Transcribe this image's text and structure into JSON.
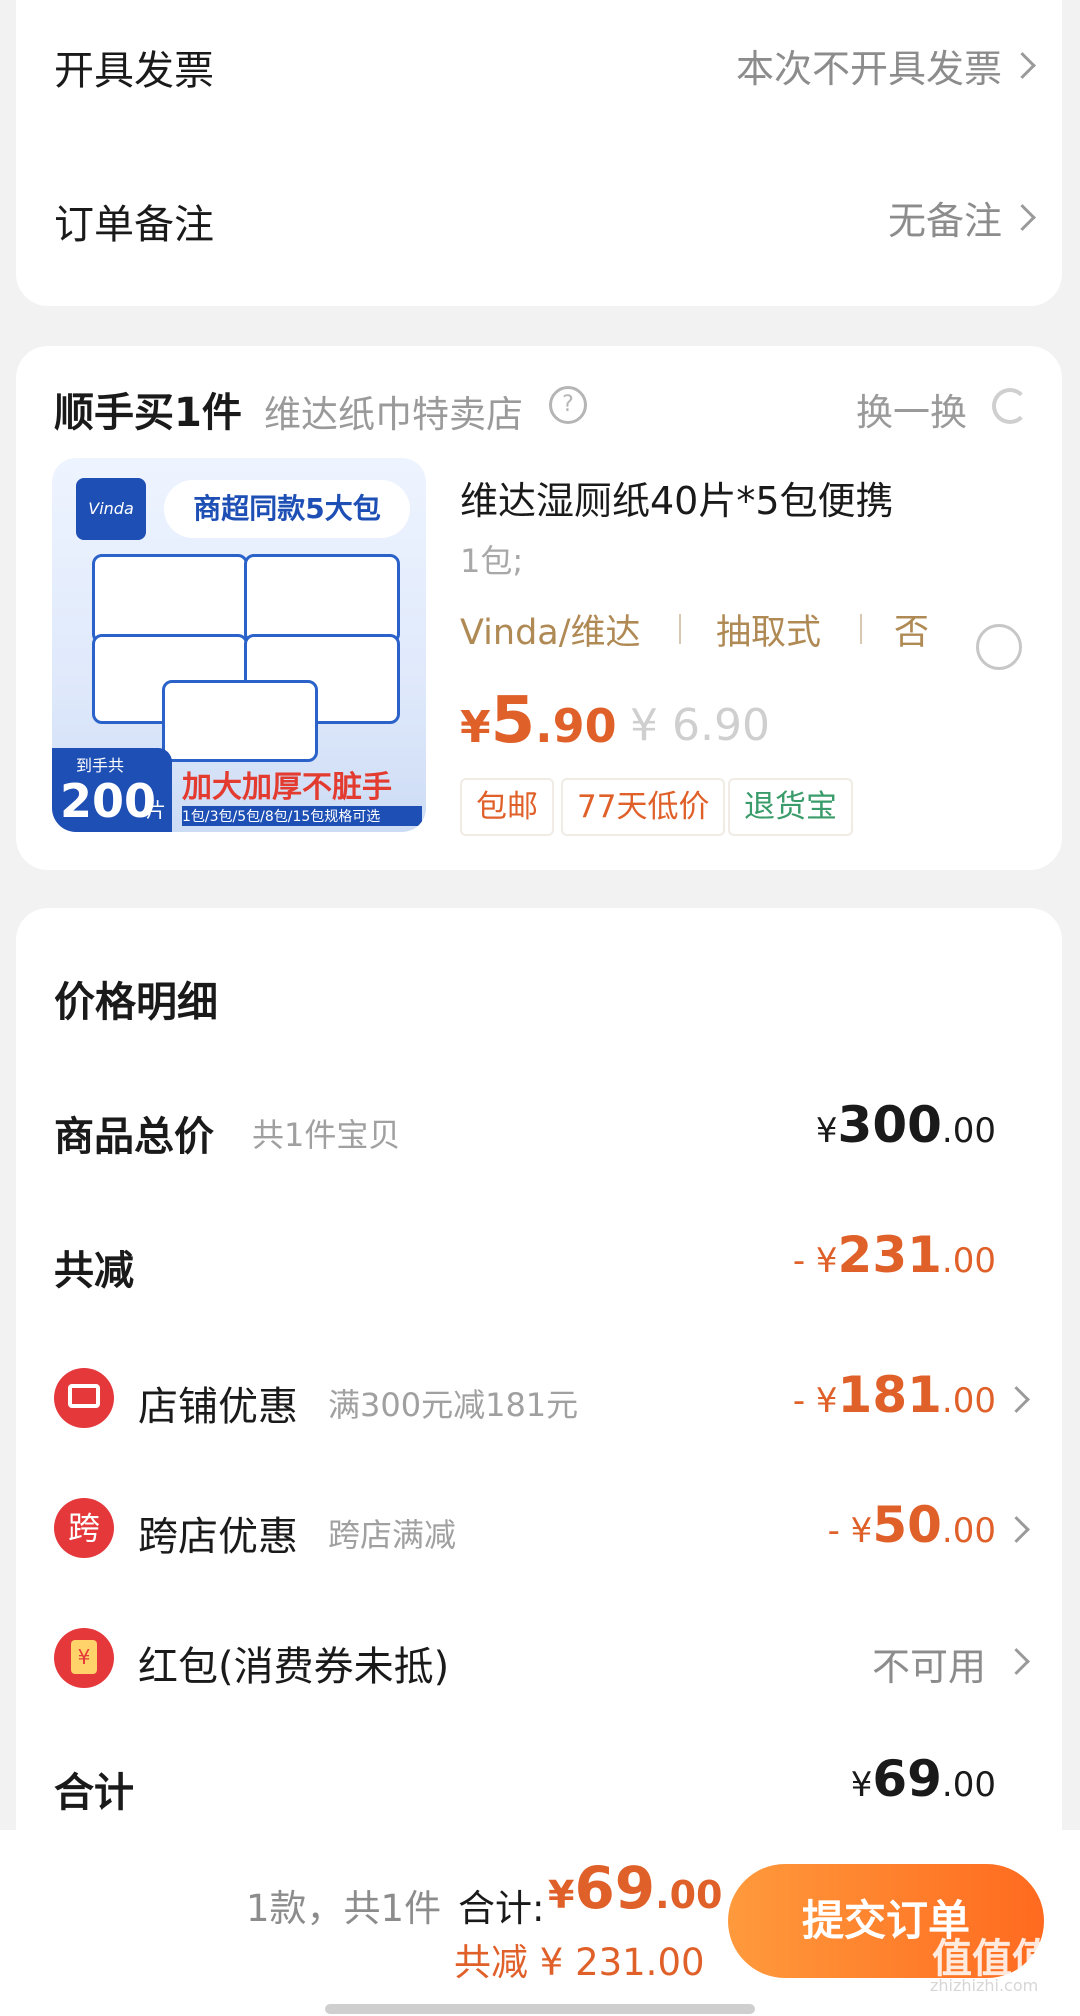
{
  "invoice": {
    "label": "开具发票",
    "value": "本次不开具发票"
  },
  "remark": {
    "label": "订单备注",
    "value": "无备注"
  },
  "addon": {
    "title": "顺手买1件",
    "store": "维达纸巾特卖店",
    "swap_label": "换一换",
    "product": {
      "image": {
        "top_banner": "商超同款5大包",
        "bottom_banner": "加大加厚不脏手",
        "badge_top": "到手共",
        "badge_num": "200",
        "badge_unit": "片",
        "spec_line": "1包/3包/5包/8包/15包规格可选",
        "brand_logo": "Vinda"
      },
      "name": "维达湿厕纸40片*5包便携",
      "spec": "1包;",
      "attrs": [
        "Vinda/维达",
        "抽取式",
        "否"
      ],
      "price_yen": "¥",
      "price_int": "5",
      "price_dec": ".90",
      "original_price": "¥ 6.90",
      "tags": [
        "包邮",
        "77天低价",
        "退货宝"
      ]
    }
  },
  "price_detail": {
    "title": "价格明细",
    "total": {
      "label": "商品总价",
      "sub": "共1件宝贝",
      "yen": "¥",
      "int": "300",
      "dec": ".00"
    },
    "reduce": {
      "label": "共减",
      "prefix": "- ¥",
      "int": "231",
      "dec": ".00"
    },
    "shop_discount": {
      "label": "店铺优惠",
      "sub": "满300元减181元",
      "prefix": "- ¥",
      "int": "181",
      "dec": ".00"
    },
    "cross_discount": {
      "label": "跨店优惠",
      "icon_char": "跨",
      "sub": "跨店满减",
      "prefix": "- ¥",
      "int": "50",
      "dec": ".00"
    },
    "red_packet": {
      "label": "红包(消费券未抵)",
      "icon_char": "¥",
      "value": "不可用"
    },
    "sum": {
      "label": "合计",
      "yen": "¥",
      "int": "69",
      "dec": ".00"
    }
  },
  "bottom_bar": {
    "count": "1款，共1件",
    "total_label": "合计:",
    "total_yen": "¥",
    "total_int": "69",
    "total_dec": ".00",
    "reduce_text": "共减 ¥ 231.00",
    "submit": "提交订单",
    "watermark": "值值值",
    "watermark_url": "zhizhizhi.com"
  },
  "colors": {
    "accent": "#e0602a",
    "button": "#ff7a2a",
    "tag_text": "#b08a55",
    "red_icon": "#e5383b"
  }
}
